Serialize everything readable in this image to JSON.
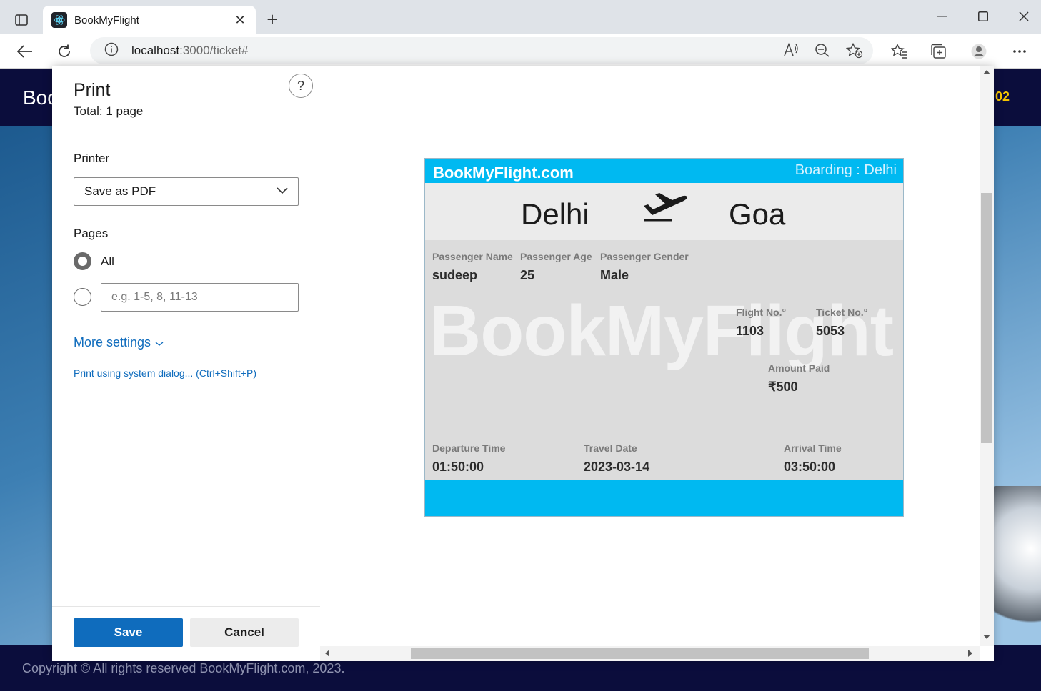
{
  "browser": {
    "tab_title": "BookMyFlight",
    "url_host": "localhost",
    "url_rest": ":3000/ticket#"
  },
  "page": {
    "logo": "Boo",
    "user_fragment": "02",
    "footer": "Copyright © All rights reserved BookMyFlight.com, 2023."
  },
  "print": {
    "title": "Print",
    "total": "Total: 1 page",
    "help": "?",
    "printer_label": "Printer",
    "printer_value": "Save as PDF",
    "pages_label": "Pages",
    "pages_all": "All",
    "pages_placeholder": "e.g. 1-5, 8, 11-13",
    "more_settings": "More settings",
    "system_dialog": "Print using system dialog... (Ctrl+Shift+P)",
    "save": "Save",
    "cancel": "Cancel"
  },
  "ticket": {
    "brand": "BookMyFlight.com",
    "boarding": "Boarding : Delhi",
    "from": "Delhi",
    "to": "Goa",
    "watermark": "BookMyFlight",
    "passenger_name_label": "Passenger Name",
    "passenger_name": "sudeep",
    "passenger_age_label": "Passenger Age",
    "passenger_age": "25",
    "passenger_gender_label": "Passenger Gender",
    "passenger_gender": "Male",
    "flight_no_label": "Flight No.°",
    "flight_no": "1103",
    "ticket_no_label": "Ticket No.°",
    "ticket_no": "5053",
    "amount_label": "Amount Paid",
    "amount": "₹500",
    "departure_label": "Departure Time",
    "departure": "01:50:00",
    "date_label": "Travel Date",
    "date": "2023-03-14",
    "arrival_label": "Arrival Time",
    "arrival": "03:50:00"
  },
  "colors": {
    "accent": "#0f6cbd",
    "ticket_blue": "#00b9f1",
    "page_navy": "#0b0d3c"
  }
}
